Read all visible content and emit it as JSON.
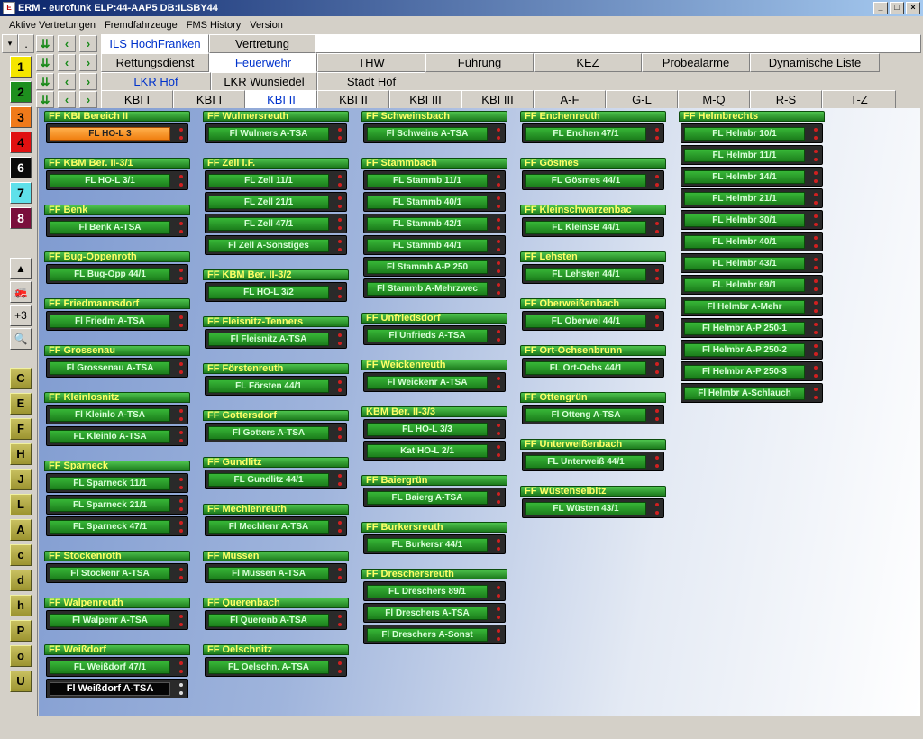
{
  "window": {
    "title": "ERM - eurofunk  ELP:44-AAP5  DB:ILSBY44",
    "buttons": [
      "_",
      "□",
      "×"
    ]
  },
  "menu": [
    "Aktive Vertretungen",
    "Fremdfahrzeuge",
    "FMS History",
    "Version"
  ],
  "row1": {
    "dropdown": "▾",
    "dot": ".",
    "tabs": [
      "ILS HochFranken",
      "Vertretung"
    ]
  },
  "row2": {
    "tabs": [
      "Rettungsdienst",
      "Feuerwehr",
      "THW",
      "Führung",
      "KEZ",
      "Probealarme",
      "Dynamische Liste"
    ]
  },
  "row3": {
    "tabs": [
      "LKR Hof",
      "LKR Wunsiedel",
      "Stadt Hof"
    ]
  },
  "row4": {
    "tabs": [
      "KBI I",
      "KBI I",
      "KBI II",
      "KBI II",
      "KBI III",
      "KBI III",
      "A-F",
      "G-L",
      "M-Q",
      "R-S",
      "T-Z"
    ]
  },
  "nav_icons": [
    "chevron-double-down-icon",
    "chevron-left-icon",
    "chevron-right-icon"
  ],
  "left_numbers": [
    {
      "label": "1",
      "bg": "#f5e600",
      "fg": "#000"
    },
    {
      "label": "2",
      "bg": "#1e8f1e",
      "fg": "#000"
    },
    {
      "label": "3",
      "bg": "#f07a1a",
      "fg": "#000"
    },
    {
      "label": "4",
      "bg": "#e01010",
      "fg": "#000"
    },
    {
      "label": "6",
      "bg": "#0a0a0a",
      "fg": "#fff"
    },
    {
      "label": "7",
      "bg": "#5fe0ea",
      "fg": "#000"
    },
    {
      "label": "8",
      "bg": "#7a0f3c",
      "fg": "#fff"
    }
  ],
  "left_tools": [
    {
      "icon": "siren-icon",
      "glyph": "▲"
    },
    {
      "icon": "vehicle-icon",
      "glyph": "🚒"
    },
    {
      "icon": "plus-three-icon",
      "glyph": "+3"
    },
    {
      "icon": "magnifier-icon",
      "glyph": "🔍"
    }
  ],
  "left_letters": [
    "C",
    "E",
    "F",
    "H",
    "J",
    "L",
    "A",
    "c",
    "d",
    "h",
    "P",
    "o",
    "U"
  ],
  "columns": [
    [
      {
        "name": "FF KBI Bereich II",
        "units": [
          {
            "label": "FL HO-L 3",
            "style": "orange"
          }
        ]
      },
      {
        "name": "FF KBM Ber. II-3/1",
        "units": [
          {
            "label": "FL HO-L 3/1"
          }
        ]
      },
      {
        "name": "FF Benk",
        "units": [
          {
            "label": "Fl Benk A-TSA"
          }
        ]
      },
      {
        "name": "FF Bug-Oppenroth",
        "units": [
          {
            "label": "FL Bug-Opp 44/1"
          }
        ]
      },
      {
        "name": "FF Friedmannsdorf",
        "units": [
          {
            "label": "Fl Friedm A-TSA"
          }
        ]
      },
      {
        "name": "FF Grossenau",
        "units": [
          {
            "label": "Fl Grossenau A-TSA"
          }
        ]
      },
      {
        "name": "FF Kleinlosnitz",
        "units": [
          {
            "label": "Fl Kleinlo A-TSA"
          },
          {
            "label": "FL Kleinlo A-TSA"
          }
        ]
      },
      {
        "name": "FF Sparneck",
        "units": [
          {
            "label": "FL Sparneck 11/1"
          },
          {
            "label": "FL Sparneck 21/1"
          },
          {
            "label": "FL Sparneck 47/1"
          }
        ]
      },
      {
        "name": "FF Stockenroth",
        "units": [
          {
            "label": "Fl Stockenr A-TSA"
          }
        ]
      },
      {
        "name": "FF Walpenreuth",
        "units": [
          {
            "label": "Fl Walpenr A-TSA"
          }
        ]
      },
      {
        "name": "FF Weißdorf",
        "units": [
          {
            "label": "FL Weißdorf 47/1"
          },
          {
            "label": "Fl Weißdorf A-TSA",
            "style": "black"
          }
        ]
      }
    ],
    [
      {
        "name": "FF Wulmersreuth",
        "units": [
          {
            "label": "Fl Wulmers A-TSA"
          }
        ]
      },
      {
        "name": "FF Zell i.F.",
        "units": [
          {
            "label": "FL Zell 11/1"
          },
          {
            "label": "FL Zell 21/1"
          },
          {
            "label": "FL Zell 47/1"
          },
          {
            "label": "Fl Zell A-Sonstiges"
          }
        ]
      },
      {
        "name": "FF KBM Ber. II-3/2",
        "units": [
          {
            "label": "FL HO-L 3/2"
          }
        ]
      },
      {
        "name": "FF Fleisnitz-Tenners",
        "units": [
          {
            "label": "Fl Fleisnitz A-TSA"
          }
        ]
      },
      {
        "name": "FF Förstenreuth",
        "units": [
          {
            "label": "FL Försten 44/1"
          }
        ]
      },
      {
        "name": "FF Gottersdorf",
        "units": [
          {
            "label": "Fl Gotters A-TSA"
          }
        ]
      },
      {
        "name": "FF Gundlitz",
        "units": [
          {
            "label": "FL Gundlitz 44/1"
          }
        ]
      },
      {
        "name": "FF Mechlenreuth",
        "units": [
          {
            "label": "Fl Mechlenr A-TSA"
          }
        ]
      },
      {
        "name": "FF Mussen",
        "units": [
          {
            "label": "Fl Mussen A-TSA"
          }
        ]
      },
      {
        "name": "FF Querenbach",
        "units": [
          {
            "label": "Fl Querenb A-TSA"
          }
        ]
      },
      {
        "name": "FF Oelschnitz",
        "units": [
          {
            "label": "FL Oelschn. A-TSA"
          }
        ]
      }
    ],
    [
      {
        "name": "FF Schweinsbach",
        "units": [
          {
            "label": "Fl Schweins A-TSA"
          }
        ]
      },
      {
        "name": "FF Stammbach",
        "units": [
          {
            "label": "FL Stammb 11/1"
          },
          {
            "label": "FL Stammb 40/1"
          },
          {
            "label": "FL Stammb 42/1"
          },
          {
            "label": "FL Stammb 44/1"
          },
          {
            "label": "Fl Stammb A-P 250"
          },
          {
            "label": "Fl Stammb A-Mehrzwec"
          }
        ]
      },
      {
        "name": "FF Unfriedsdorf",
        "units": [
          {
            "label": "Fl Unfrieds A-TSA"
          }
        ]
      },
      {
        "name": "FF Weickenreuth",
        "units": [
          {
            "label": "Fl Weickenr A-TSA"
          }
        ]
      },
      {
        "name": "KBM Ber. II-3/3",
        "units": [
          {
            "label": "FL HO-L 3/3"
          },
          {
            "label": "Kat HO-L 2/1"
          }
        ]
      },
      {
        "name": "FF Baiergrün",
        "units": [
          {
            "label": "FL Baierg A-TSA"
          }
        ]
      },
      {
        "name": "FF Burkersreuth",
        "units": [
          {
            "label": "FL Burkersr 44/1"
          }
        ]
      },
      {
        "name": "FF Dreschersreuth",
        "units": [
          {
            "label": "FL Dreschers 89/1"
          },
          {
            "label": "Fl Dreschers A-TSA"
          },
          {
            "label": "Fl Dreschers A-Sonst"
          }
        ]
      }
    ],
    [
      {
        "name": "FF Enchenreuth",
        "units": [
          {
            "label": "FL Enchen 47/1"
          }
        ]
      },
      {
        "name": "FF Gösmes",
        "units": [
          {
            "label": "FL Gösmes 44/1"
          }
        ]
      },
      {
        "name": "FF Kleinschwarzenbac",
        "units": [
          {
            "label": "FL KleinSB 44/1"
          }
        ]
      },
      {
        "name": "FF Lehsten",
        "units": [
          {
            "label": "FL Lehsten 44/1"
          }
        ]
      },
      {
        "name": "FF Oberweißenbach",
        "units": [
          {
            "label": "FL Oberwei 44/1"
          }
        ]
      },
      {
        "name": "FF Ort-Ochsenbrunn",
        "units": [
          {
            "label": "FL Ort-Ochs 44/1"
          }
        ]
      },
      {
        "name": "FF Ottengrün",
        "units": [
          {
            "label": "Fl Otteng A-TSA"
          }
        ]
      },
      {
        "name": "FF Unterweißenbach",
        "units": [
          {
            "label": "FL Unterweiß 44/1"
          }
        ]
      },
      {
        "name": "FF Wüstenselbitz",
        "units": [
          {
            "label": "FL Wüsten 43/1"
          }
        ]
      }
    ],
    [
      {
        "name": "FF Helmbrechts",
        "units": [
          {
            "label": "FL Helmbr 10/1"
          },
          {
            "label": "FL Helmbr 11/1"
          },
          {
            "label": "FL Helmbr 14/1"
          },
          {
            "label": "FL Helmbr 21/1"
          },
          {
            "label": "FL Helmbr 30/1"
          },
          {
            "label": "FL Helmbr 40/1"
          },
          {
            "label": "FL Helmbr 43/1"
          },
          {
            "label": "FL Helmbr 69/1"
          },
          {
            "label": "Fl Helmbr A-Mehr"
          },
          {
            "label": "Fl Helmbr A-P 250-1"
          },
          {
            "label": "Fl Helmbr A-P 250-2"
          },
          {
            "label": "Fl Helmbr A-P 250-3"
          },
          {
            "label": "Fl Helmbr A-Schlauch"
          }
        ]
      }
    ]
  ]
}
